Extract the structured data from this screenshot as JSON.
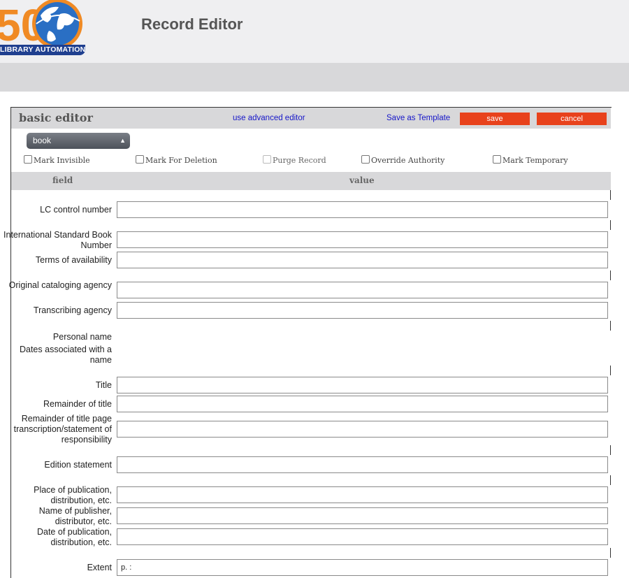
{
  "header": {
    "logo_number": "50",
    "logo_caption": "LIBRARY AUTOMATION",
    "title": "Record Editor"
  },
  "toolbar": {
    "editor_title": "basic editor",
    "advanced_link": "use advanced editor",
    "template_link": "Save as Template",
    "save_label": "save",
    "cancel_label": "cancel",
    "accent_color": "#e8421c"
  },
  "record_type": {
    "selected": "book"
  },
  "options": {
    "mark_invisible": "Mark Invisible",
    "mark_for_deletion": "Mark For Deletion",
    "purge_record": "Purge Record",
    "override_authority": "Override Authority",
    "mark_temporary": "Mark Temporary"
  },
  "columns": {
    "field": "field",
    "value": "value"
  },
  "fields": {
    "lc_control_number": {
      "label": "LC control number",
      "value": ""
    },
    "isbn": {
      "label": "International Standard Book Number",
      "value": ""
    },
    "terms_of_availability": {
      "label": "Terms of availability",
      "value": ""
    },
    "original_cataloging_agency": {
      "label": "Original cataloging agency",
      "value": ""
    },
    "transcribing_agency": {
      "label": "Transcribing agency",
      "value": ""
    },
    "personal_name": {
      "label": "Personal name"
    },
    "dates_associated": {
      "label": "Dates associated with a name"
    },
    "title": {
      "label": "Title",
      "value": ""
    },
    "remainder_of_title": {
      "label": "Remainder of title",
      "value": ""
    },
    "statement_of_responsibility": {
      "label": "Remainder of title page transcription/statement of responsibility",
      "value": ""
    },
    "edition_statement": {
      "label": "Edition statement",
      "value": ""
    },
    "place_of_publication": {
      "label": "Place of publication, distribution, etc.",
      "value": ""
    },
    "name_of_publisher": {
      "label": "Name of publisher, distributor, etc.",
      "value": ""
    },
    "date_of_publication": {
      "label": "Date of publication, distribution, etc.",
      "value": ""
    },
    "extent": {
      "label": "Extent",
      "value": "p. :"
    }
  }
}
